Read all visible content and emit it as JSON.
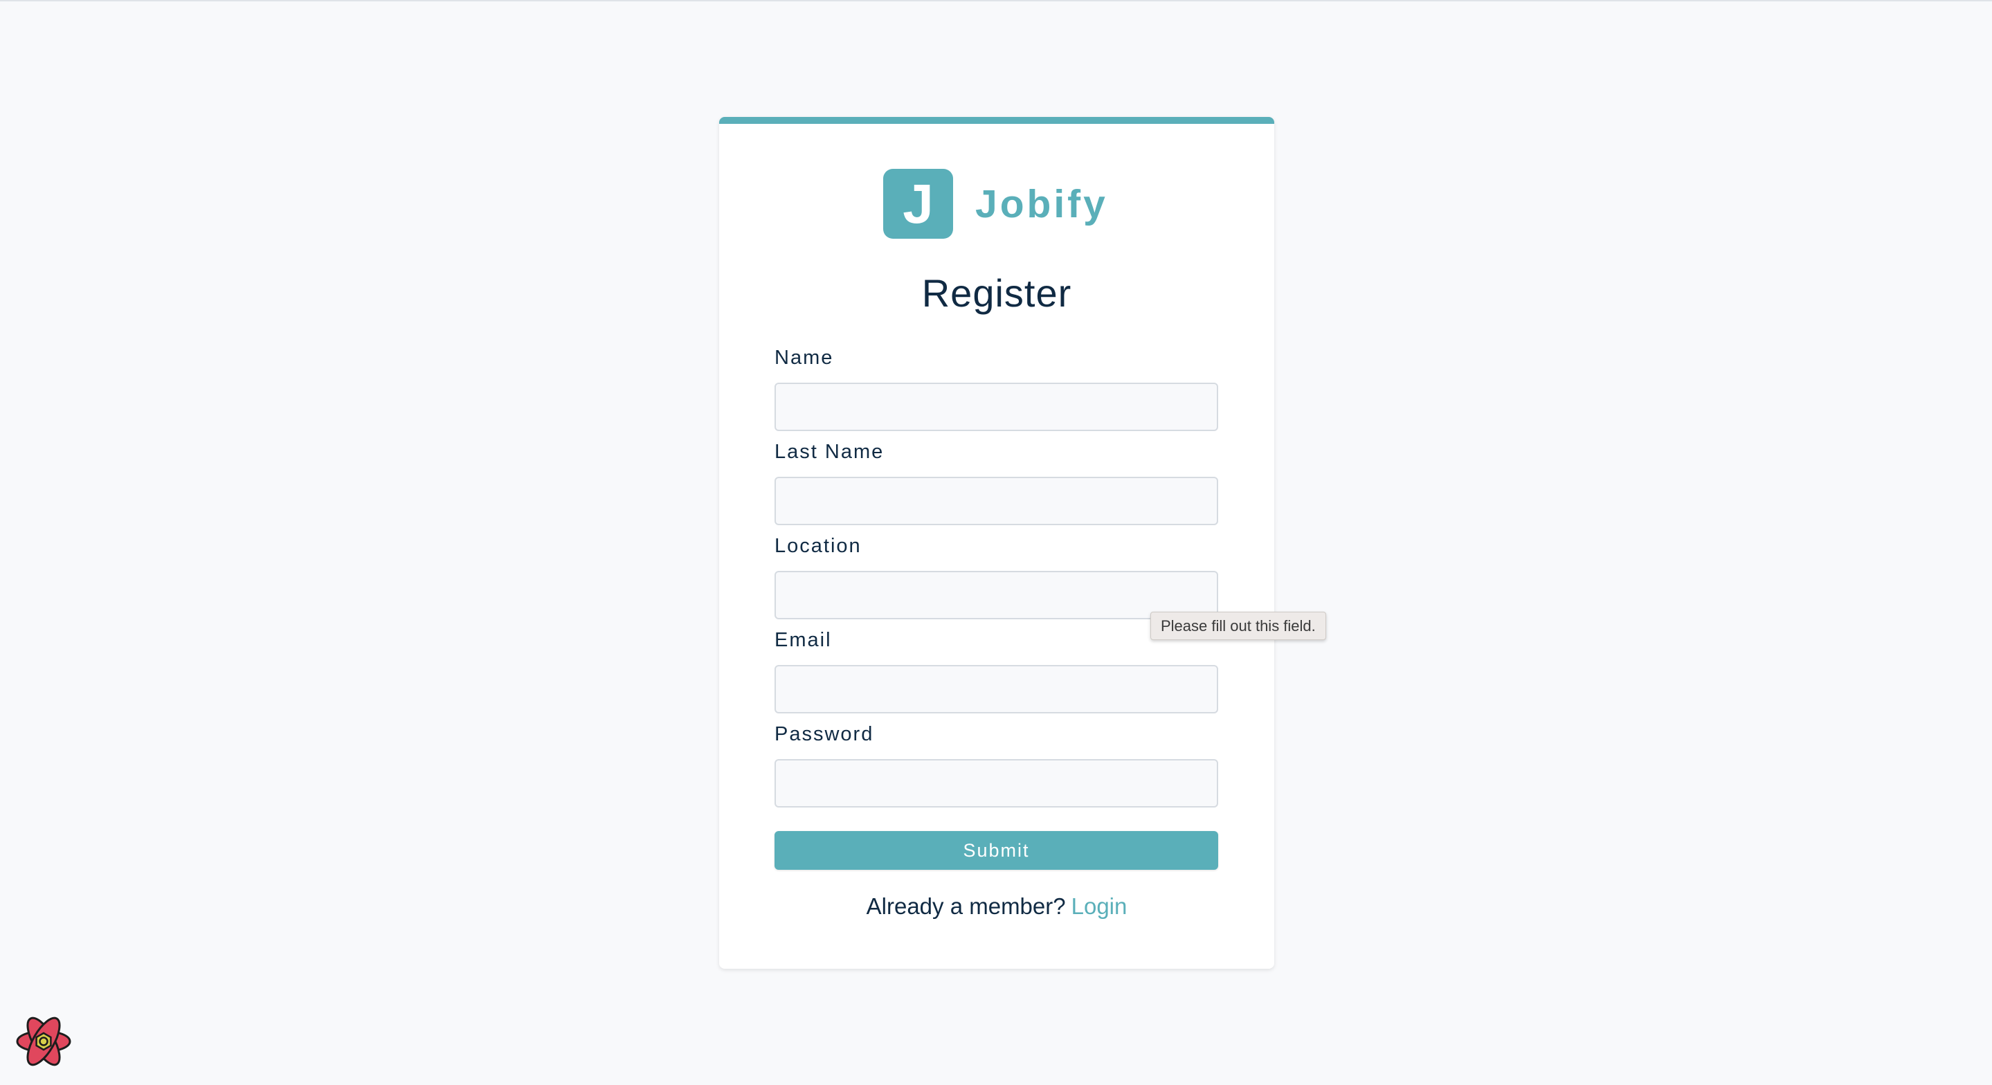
{
  "brand": {
    "logo_letter": "J",
    "name": "Jobify",
    "accent_color": "#5aafb9"
  },
  "form": {
    "title": "Register",
    "fields": [
      {
        "label": "Name",
        "value": ""
      },
      {
        "label": "Last Name",
        "value": ""
      },
      {
        "label": "Location",
        "value": ""
      },
      {
        "label": "Email",
        "value": ""
      },
      {
        "label": "Password",
        "value": ""
      }
    ],
    "submit_label": "Submit",
    "footer_prompt": "Already a member?",
    "footer_link": "Login"
  },
  "validation_tooltip": "Please fill out this field.",
  "devtools_icon": "react-devtools-icon"
}
